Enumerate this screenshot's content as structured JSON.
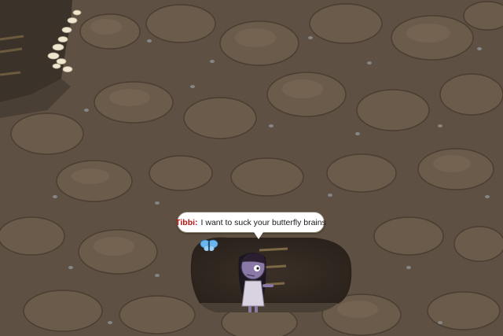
{
  "chat": {
    "speaker": "Tibbi:",
    "message": "I want to suck  your butterfly brains"
  },
  "colors": {
    "dirt": "#5c4e40",
    "rock_dark": "#3f342a",
    "rock_light": "#7a6a58",
    "pebble": "#8d8f92",
    "cave_shadow": "#2e261f",
    "butterfly": "#6ab6ef",
    "speaker_name": "#b81414"
  },
  "icons": {
    "butterfly": "butterfly-icon",
    "mushrooms": "mushroom-cluster-icon",
    "ladder": "ladder-icon",
    "player": "zombie-girl-avatar"
  }
}
